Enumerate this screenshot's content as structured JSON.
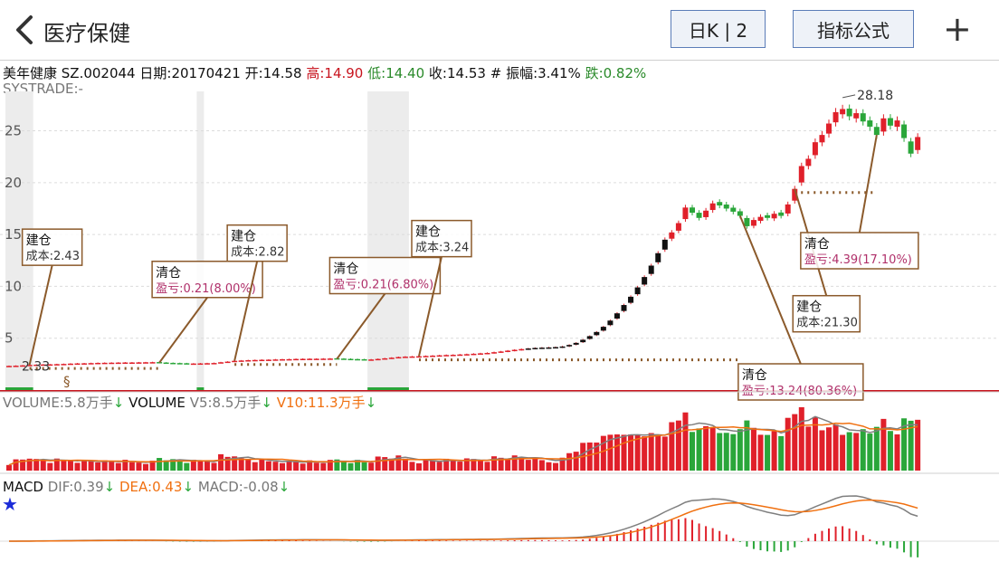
{
  "header": {
    "title": "医疗保健",
    "period_button": "日K | 2",
    "formula_button": "指标公式",
    "add_button": "+"
  },
  "info": {
    "stock": "美年健康 SZ.002044",
    "date": "日期:20170421",
    "open": "开:14.58",
    "high": "高:14.90",
    "low": "低:14.40",
    "close": "收:14.53",
    "hash": "#",
    "amplitude": "振幅:3.41%",
    "change": "跌:0.82%",
    "systrade": "SYSTRADE:-"
  },
  "volume_bar": {
    "volume": "VOLUME:5.8万手",
    "label": "VOLUME",
    "v5": "V5:8.5万手",
    "v10": "V10:11.3万手",
    "arrow": "↓"
  },
  "macd_bar": {
    "label": "MACD",
    "dif": "DIF:0.39",
    "dea": "DEA:0.43",
    "macd": "MACD:-0.08",
    "arrow": "↓"
  },
  "colors": {
    "up": "#e0202a",
    "down": "#2aa63a",
    "ma5": "#7f7f7f",
    "ma10": "#f07010",
    "box": "#8b5a2b",
    "profit": "#b0306a",
    "axis_red": "#c8141e"
  },
  "chart_data": {
    "type": "candlestick",
    "ylim": [
      0,
      28.8
    ],
    "yticks": [
      5,
      10,
      15,
      20,
      25
    ],
    "max_label": "28.18",
    "start_label": "2.33",
    "start_marker": "§",
    "annotations": [
      {
        "title": "建仓",
        "text": "成本:2.43",
        "style": "cost",
        "i": 3
      },
      {
        "title": "清仓",
        "text": "盈亏:0.21(8.00%)",
        "style": "profit",
        "i": 22
      },
      {
        "title": "建仓",
        "text": "成本:2.82",
        "style": "cost",
        "i": 33
      },
      {
        "title": "清仓",
        "text": "盈亏:0.21(6.80%)",
        "style": "profit",
        "i": 48
      },
      {
        "title": "建仓",
        "text": "成本:3.24",
        "style": "cost",
        "i": 60
      },
      {
        "title": "清仓",
        "text": "盈亏:13.24(80.36%)",
        "style": "profit",
        "i": 107
      },
      {
        "title": "建仓",
        "text": "成本:21.30",
        "style": "cost",
        "i": 115
      },
      {
        "title": "清仓",
        "text": "盈亏:4.39(17.10%)",
        "style": "profit",
        "i": 127
      }
    ],
    "shaded_ranges": [
      [
        0,
        3
      ],
      [
        28,
        28
      ],
      [
        53,
        58
      ]
    ],
    "closes": [
      2.33,
      2.35,
      2.38,
      2.43,
      2.45,
      2.47,
      2.48,
      2.5,
      2.52,
      2.55,
      2.57,
      2.58,
      2.6,
      2.62,
      2.63,
      2.64,
      2.65,
      2.66,
      2.66,
      2.67,
      2.68,
      2.69,
      2.64,
      2.6,
      2.58,
      2.56,
      2.55,
      2.56,
      2.57,
      2.59,
      2.61,
      2.68,
      2.74,
      2.82,
      2.85,
      2.88,
      2.9,
      2.92,
      2.93,
      2.95,
      2.97,
      2.98,
      3.0,
      3.01,
      3.02,
      3.02,
      3.03,
      3.04,
      3.01,
      2.98,
      2.96,
      2.94,
      2.93,
      2.95,
      3.0,
      3.06,
      3.12,
      3.18,
      3.22,
      3.24,
      3.26,
      3.29,
      3.32,
      3.35,
      3.38,
      3.4,
      3.43,
      3.46,
      3.5,
      3.54,
      3.58,
      3.65,
      3.72,
      3.8,
      3.88,
      3.95,
      4.01,
      4.06,
      4.09,
      4.11,
      4.14,
      4.2,
      4.35,
      4.55,
      4.85,
      5.2,
      5.6,
      6.1,
      6.7,
      7.4,
      8.2,
      9.0,
      9.9,
      10.9,
      12.0,
      13.2,
      14.5,
      15.2,
      16.1,
      17.6,
      17.1,
      16.6,
      17.3,
      18.0,
      17.8,
      17.5,
      17.2,
      16.8,
      15.8,
      16.4,
      16.7,
      16.6,
      17.0,
      16.8,
      17.9,
      19.4,
      21.6,
      22.3,
      23.9,
      24.6,
      25.7,
      26.8,
      27.1,
      26.4,
      26.7,
      25.9,
      25.4,
      24.6,
      26.2,
      25.5,
      26.0,
      24.3,
      22.8,
      24.4
    ]
  }
}
